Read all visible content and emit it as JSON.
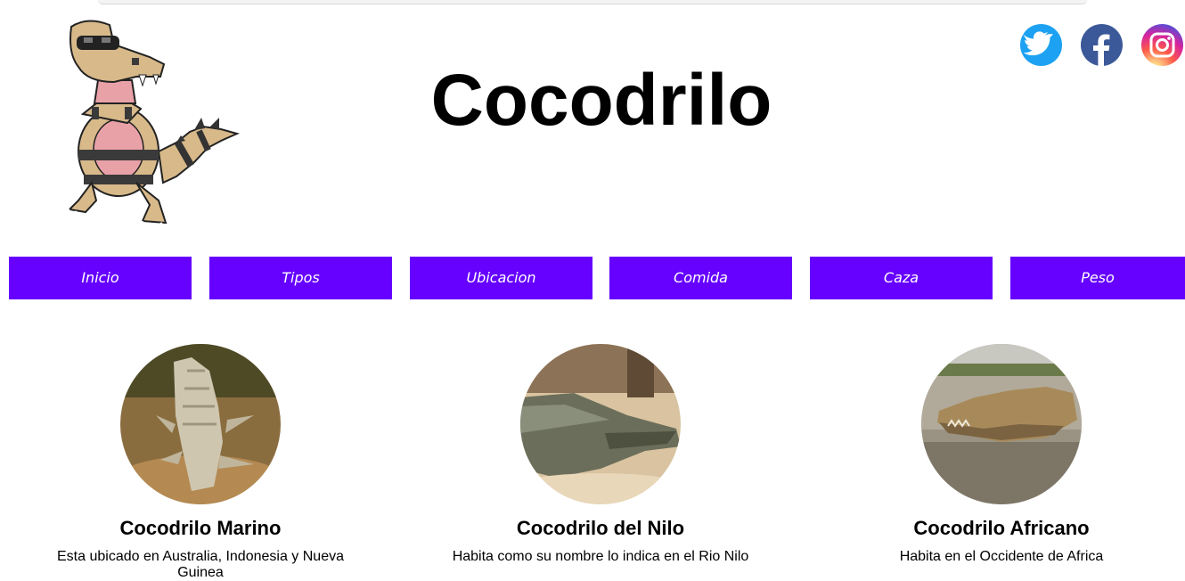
{
  "header": {
    "title": "Cocodrilo",
    "mascot_icon": "crocodile-mascot-icon",
    "social": [
      {
        "name": "twitter-icon",
        "color": "#1da1f2"
      },
      {
        "name": "facebook-icon",
        "color": "#3b5998"
      },
      {
        "name": "instagram-icon",
        "color": "#d6249f"
      }
    ]
  },
  "nav": {
    "accent_color": "#6600ff",
    "items": [
      {
        "label": "Inicio"
      },
      {
        "label": "Tipos"
      },
      {
        "label": "Ubicacion"
      },
      {
        "label": "Comida"
      },
      {
        "label": "Caza"
      },
      {
        "label": "Peso"
      }
    ]
  },
  "cards": [
    {
      "title": "Cocodrilo Marino",
      "description": "Esta ubicado en Australia, Indonesia y Nueva Guinea"
    },
    {
      "title": "Cocodrilo del Nilo",
      "description": "Habita como su nombre lo indica en el Rio Nilo"
    },
    {
      "title": "Cocodrilo Africano",
      "description": "Habita en el Occidente de Africa"
    }
  ]
}
